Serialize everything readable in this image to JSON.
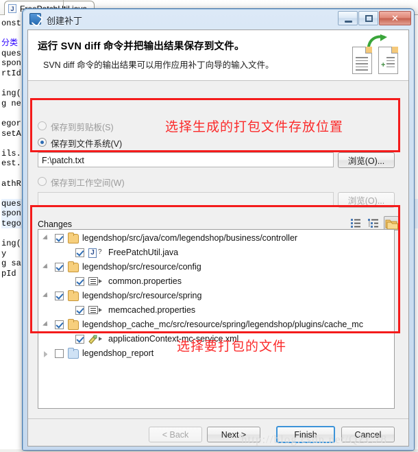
{
  "background": {
    "editor_tab_label": "FreePatchUtil.java",
    "code_lines": [
      "onst",
      "",
      "分类",
      "ques",
      "spon",
      "rtId",
      "",
      "ing(",
      "g ne",
      "",
      "egor",
      "setA",
      "",
      "ils.",
      "est.",
      "",
      "athR",
      "",
      "ques",
      "spon",
      "tego",
      "",
      "ing(",
      "y",
      "g sa",
      "pId"
    ]
  },
  "dialog": {
    "title": "创建补丁",
    "window_buttons": {
      "minimize": "minimize-icon",
      "maximize": "maximize-icon",
      "close": "✕"
    },
    "banner": {
      "title": "运行 SVN diff 命令并把输出结果保存到文件。",
      "subtitle": "SVN diff 命令的输出结果可以用作应用补丁向导的输入文件。",
      "icon": "diff-to-file-icon"
    },
    "options": [
      {
        "label": "保存到剪贴板(S)",
        "selected": false,
        "enabled": true
      },
      {
        "label": "保存到文件系统(V)",
        "selected": true,
        "enabled": true
      },
      {
        "label": "保存到工作空间(W)",
        "selected": false,
        "enabled": false
      }
    ],
    "file_path_field": {
      "value": "F:\\patch.txt",
      "placeholder": "",
      "enabled": true
    },
    "workspace_field": {
      "value": "",
      "placeholder": "",
      "enabled": false
    },
    "browse_button_file": "浏览(O)...",
    "browse_button_workspace": "浏览(O)...",
    "changes": {
      "group_label": "Changes",
      "toolbar": [
        {
          "name": "flat-layout-icon",
          "pressed": false
        },
        {
          "name": "tree-layout-icon",
          "pressed": false
        },
        {
          "name": "compressed-folders-icon",
          "pressed": true
        }
      ],
      "tree": [
        {
          "indent": 0,
          "arrow": "down",
          "checked": true,
          "icon": "folder-open-icon",
          "label": "legendshop/src/java/com/legendshop/business/controller"
        },
        {
          "indent": 1,
          "arrow": "none",
          "checked": true,
          "icon": "java-file-icon",
          "label": "FreePatchUtil.java"
        },
        {
          "indent": 0,
          "arrow": "down",
          "checked": true,
          "icon": "folder-open-icon",
          "label": "legendshop/src/resource/config"
        },
        {
          "indent": 1,
          "arrow": "none",
          "checked": true,
          "icon": "properties-file-icon",
          "label": "common.properties"
        },
        {
          "indent": 0,
          "arrow": "down",
          "checked": true,
          "icon": "folder-open-icon",
          "label": "legendshop/src/resource/spring"
        },
        {
          "indent": 1,
          "arrow": "none",
          "checked": true,
          "icon": "properties-file-icon",
          "label": "memcached.properties"
        },
        {
          "indent": 0,
          "arrow": "down",
          "checked": true,
          "icon": "folder-open-icon",
          "label": "legendshop_cache_mc/src/resource/spring/legendshop/plugins/cache_mc"
        },
        {
          "indent": 1,
          "arrow": "none",
          "checked": true,
          "icon": "xml-file-icon",
          "label": "applicationContext-mc-service.xml"
        },
        {
          "indent": 0,
          "arrow": "right",
          "checked": false,
          "icon": "folder-closed-icon",
          "label": "legendshop_report"
        }
      ]
    },
    "footer_buttons": [
      {
        "label": "< Back",
        "enabled": false,
        "default": false
      },
      {
        "label": "Next >",
        "enabled": true,
        "default": false
      },
      {
        "label": "Finish",
        "enabled": true,
        "default": true
      },
      {
        "label": "Cancel",
        "enabled": true,
        "default": false
      }
    ]
  },
  "annotations": {
    "path_note": "选择生成的打包文件存放位置",
    "tree_note": "选择要打包的文件",
    "accent_color": "#fb2a2a"
  },
  "watermark": "http://blog.csdn.net/QZC78"
}
